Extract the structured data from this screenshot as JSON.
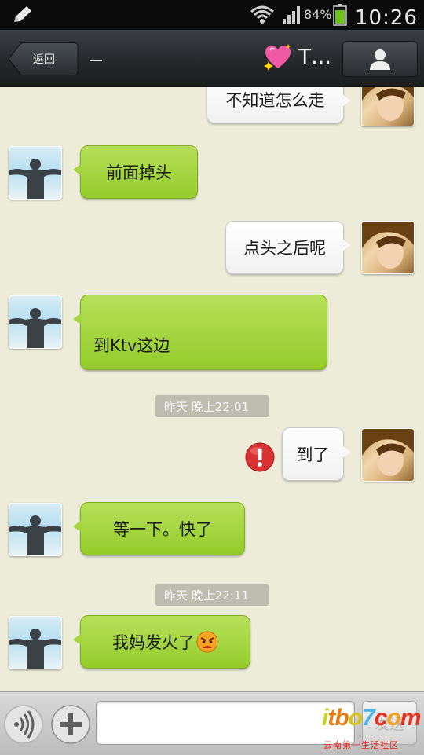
{
  "status_bar": {
    "battery": "84%",
    "time": "10:26"
  },
  "nav": {
    "back_label": "返回",
    "separator": "—",
    "title": "T…",
    "title_icon": "sparkling-heart-icon",
    "contact_icon": "person-icon"
  },
  "messages": [
    {
      "side": "out",
      "text": "不知道怎么走"
    },
    {
      "side": "in",
      "text": "前面掉头"
    },
    {
      "side": "out",
      "text": "点头之后呢"
    },
    {
      "side": "in",
      "text": "到Ktv这边"
    },
    {
      "side": "time",
      "text": "昨天 晚上22:01"
    },
    {
      "side": "out",
      "text": "到了",
      "status": "failed",
      "status_icon": "error-exclamation-icon"
    },
    {
      "side": "in",
      "text": "等一下。快了"
    },
    {
      "side": "time",
      "text": "昨天 晚上22:11"
    },
    {
      "side": "in",
      "text": "我妈发火了",
      "emoji": "angry-face-icon"
    }
  ],
  "input_bar": {
    "voice_icon": "voice-icon",
    "plus_icon": "plus-icon",
    "input_value": "",
    "send_label": "发送"
  },
  "watermark": {
    "logo": "itbo7com",
    "slogan": "云南第一生活社区"
  },
  "colors": {
    "incoming_bubble": "#a5d541",
    "outgoing_bubble": "#ffffff",
    "chat_background": "#ececd9",
    "nav_bar": "#2b2e31"
  }
}
